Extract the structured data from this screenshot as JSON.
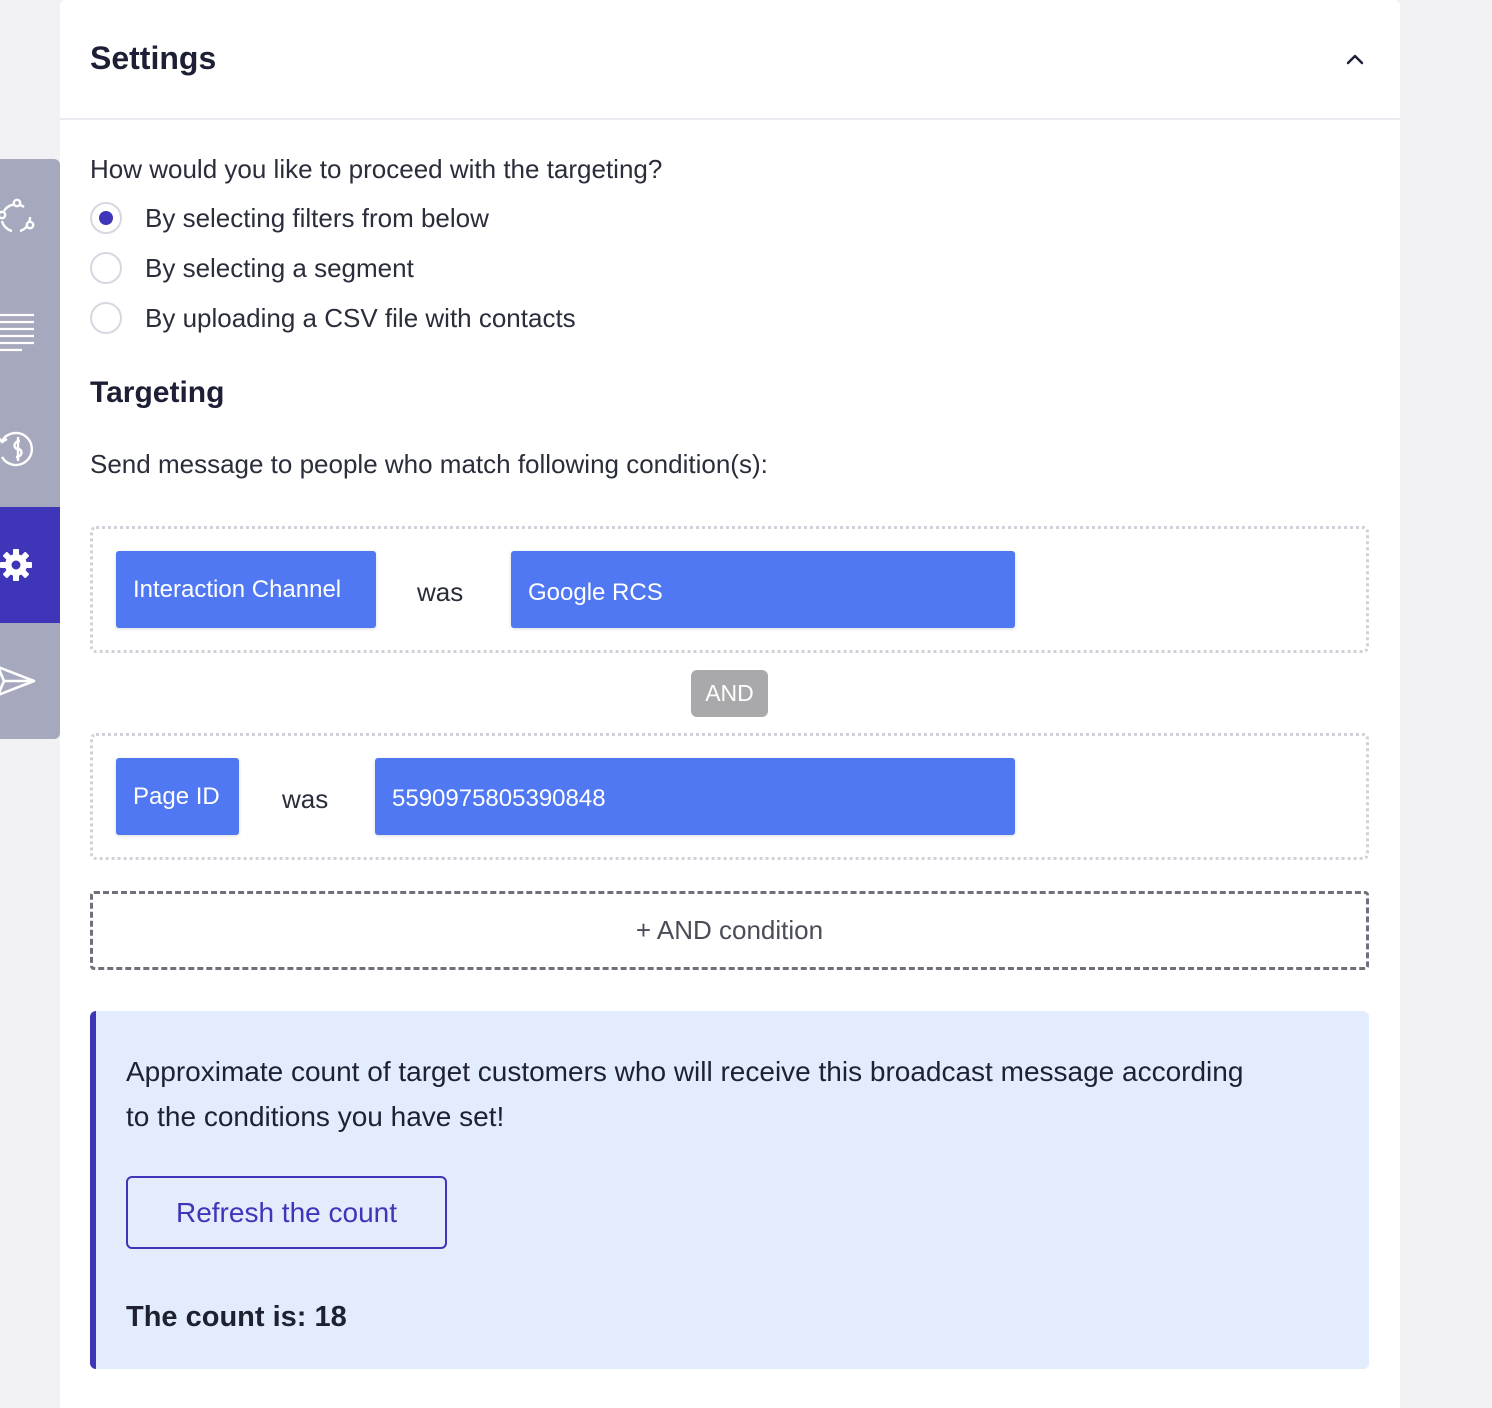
{
  "rail": {
    "items": [
      {
        "icon": "nodes-icon",
        "active": false
      },
      {
        "icon": "list-icon",
        "active": false
      },
      {
        "icon": "schedule-icon",
        "active": false
      },
      {
        "icon": "gear-icon",
        "active": true
      },
      {
        "icon": "send-icon",
        "active": false
      }
    ],
    "colors": {
      "background": "#a6a8bd",
      "active": "#3f35b8"
    }
  },
  "header": {
    "title": "Settings",
    "collapse_icon": "chevron-up-icon"
  },
  "targeting_mode": {
    "question": "How would you like to proceed with the targeting?",
    "options": [
      {
        "label": "By selecting filters from below",
        "checked": true
      },
      {
        "label": "By selecting a segment",
        "checked": false
      },
      {
        "label": "By uploading a CSV file with contacts",
        "checked": false
      }
    ]
  },
  "targeting": {
    "title": "Targeting",
    "description": "Send message to people who match following condition(s):",
    "conditions": [
      {
        "field": "Interaction Channel",
        "operator": "was",
        "value": "Google RCS"
      },
      {
        "field": "Page ID",
        "operator": "was",
        "value": "5590975805390848"
      }
    ],
    "joiner": "AND",
    "add_condition_label": "+ AND condition"
  },
  "count": {
    "description": "Approximate count of target customers who will receive this broadcast message according to the conditions you have set!",
    "refresh_label": "Refresh the count",
    "result_text": "The count is: 18"
  },
  "colors": {
    "accent": "#3f35b8",
    "chip": "#5078f2",
    "info_background": "#e2ecfc",
    "joiner_badge": "#a9a9ab"
  }
}
